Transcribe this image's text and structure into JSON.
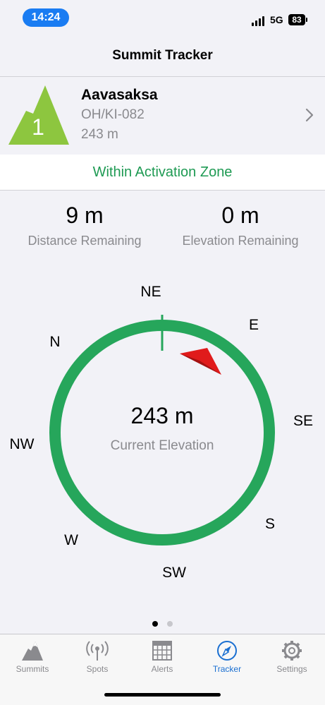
{
  "status_bar": {
    "time": "14:24",
    "network": "5G",
    "battery": "83"
  },
  "nav": {
    "title": "Summit Tracker"
  },
  "summit": {
    "rank": "1",
    "name": "Aavasaksa",
    "reference": "OH/KI-082",
    "height": "243 m",
    "badge_color": "#8dc63f"
  },
  "zone": {
    "status": "Within Activation Zone",
    "color": "#1e9a53"
  },
  "stats": {
    "distance_value": "9 m",
    "distance_label": "Distance Remaining",
    "elevation_value": "0 m",
    "elevation_label": "Elevation Remaining"
  },
  "compass": {
    "directions": {
      "ne": "NE",
      "e": "E",
      "se": "SE",
      "s": "S",
      "sw": "SW",
      "w": "W",
      "nw": "NW",
      "n": "N"
    },
    "elevation_value": "243 m",
    "elevation_label": "Current Elevation",
    "ring_color": "#26a65b",
    "pointer_color": "#e01b1b"
  },
  "pager": {
    "pages": 2,
    "current": 1
  },
  "tabs": [
    {
      "label": "Summits",
      "icon": "mountain-icon",
      "active": false
    },
    {
      "label": "Spots",
      "icon": "antenna-icon",
      "active": false
    },
    {
      "label": "Alerts",
      "icon": "calendar-icon",
      "active": false
    },
    {
      "label": "Tracker",
      "icon": "compass-icon",
      "active": true
    },
    {
      "label": "Settings",
      "icon": "gear-icon",
      "active": false
    }
  ],
  "colors": {
    "accent": "#1a6fd1",
    "inactive_tab": "#8a8a8e"
  }
}
